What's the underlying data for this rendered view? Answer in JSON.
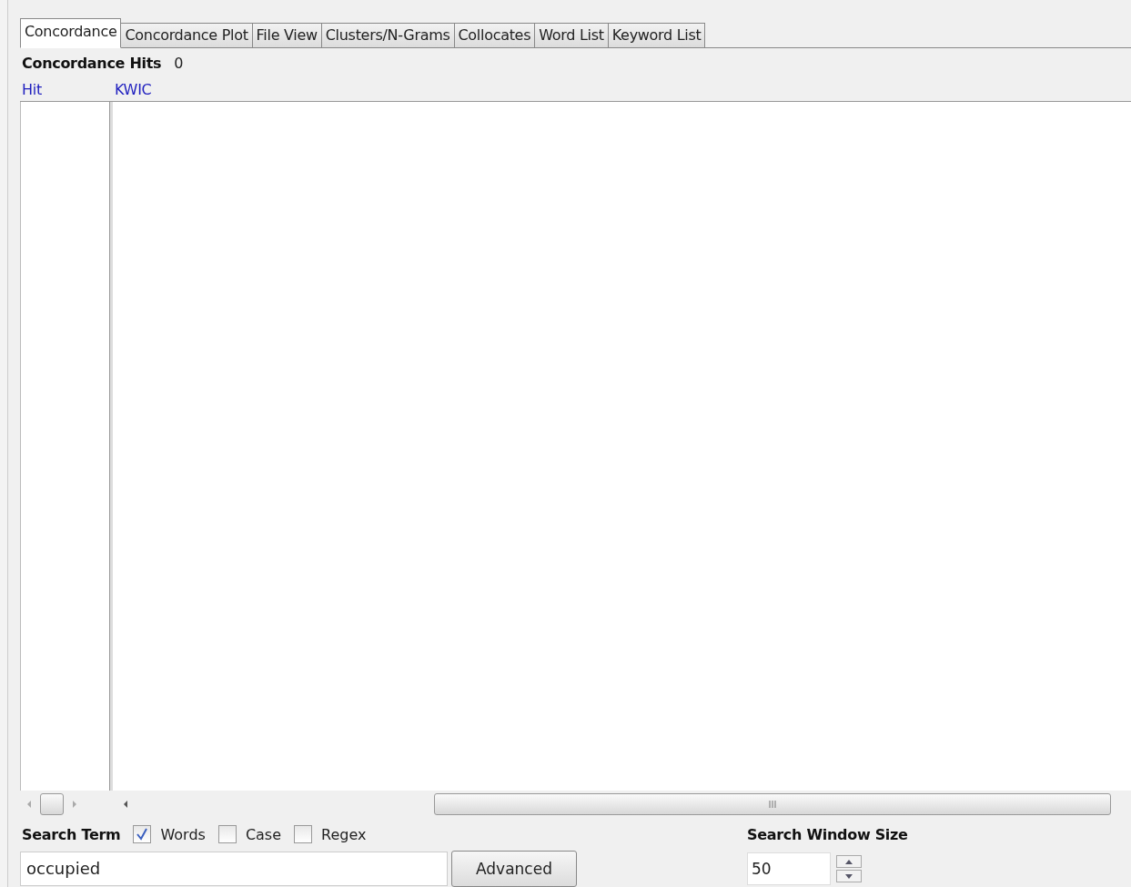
{
  "tabs": [
    {
      "label": "Concordance",
      "selected": true
    },
    {
      "label": "Concordance Plot",
      "selected": false
    },
    {
      "label": "File View",
      "selected": false
    },
    {
      "label": "Clusters/N-Grams",
      "selected": false
    },
    {
      "label": "Collocates",
      "selected": false
    },
    {
      "label": "Word List",
      "selected": false
    },
    {
      "label": "Keyword List",
      "selected": false
    }
  ],
  "hits": {
    "label": "Concordance Hits",
    "count": "0"
  },
  "table": {
    "columns": [
      "Hit",
      "KWIC"
    ]
  },
  "search": {
    "label": "Search Term",
    "options": [
      {
        "label": "Words",
        "checked": true
      },
      {
        "label": "Case",
        "checked": false
      },
      {
        "label": "Regex",
        "checked": false
      }
    ],
    "value": "occupied",
    "advanced_button": "Advanced"
  },
  "window_size": {
    "label": "Search Window Size",
    "value": "50"
  }
}
